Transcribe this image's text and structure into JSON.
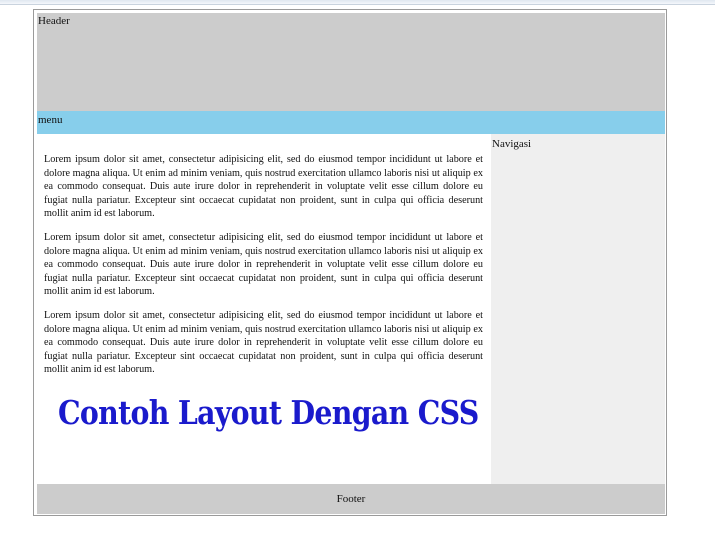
{
  "header": {
    "label": "Header"
  },
  "menu": {
    "label": "menu"
  },
  "sidebar": {
    "title": "Navigasi"
  },
  "content": {
    "paragraphs": [
      "Lorem ipsum dolor sit amet, consectetur adipisicing elit, sed do eiusmod tempor incididunt ut labore et dolore magna aliqua. Ut enim ad minim veniam, quis nostrud exercitation ullamco laboris nisi ut aliquip ex ea commodo consequat. Duis aute irure dolor in reprehenderit in voluptate velit esse cillum dolore eu fugiat nulla pariatur. Excepteur sint occaecat cupidatat non proident, sunt in culpa qui officia deserunt mollit anim id est laborum.",
      "Lorem ipsum dolor sit amet, consectetur adipisicing elit, sed do eiusmod tempor incididunt ut labore et dolore magna aliqua. Ut enim ad minim veniam, quis nostrud exercitation ullamco laboris nisi ut aliquip ex ea commodo consequat. Duis aute irure dolor in reprehenderit in voluptate velit esse cillum dolore eu fugiat nulla pariatur. Excepteur sint occaecat cupidatat non proident, sunt in culpa qui officia deserunt mollit anim id est laborum.",
      "Lorem ipsum dolor sit amet, consectetur adipisicing elit, sed do eiusmod tempor incididunt ut labore et dolore magna aliqua. Ut enim ad minim veniam, quis nostrud exercitation ullamco laboris nisi ut aliquip ex ea commodo consequat. Duis aute irure dolor in reprehenderit in voluptate velit esse cillum dolore eu fugiat nulla pariatur. Excepteur sint occaecat cupidatat non proident, sunt in culpa qui officia deserunt mollit anim id est laborum."
    ],
    "title": "Contoh Layout Dengan CSS"
  },
  "footer": {
    "label": "Footer"
  },
  "colors": {
    "header_bg": "#cccccc",
    "menu_bg": "#87ceeb",
    "sidebar_bg": "#efefef",
    "footer_bg": "#cccccc",
    "title_color": "#1a1acc"
  }
}
